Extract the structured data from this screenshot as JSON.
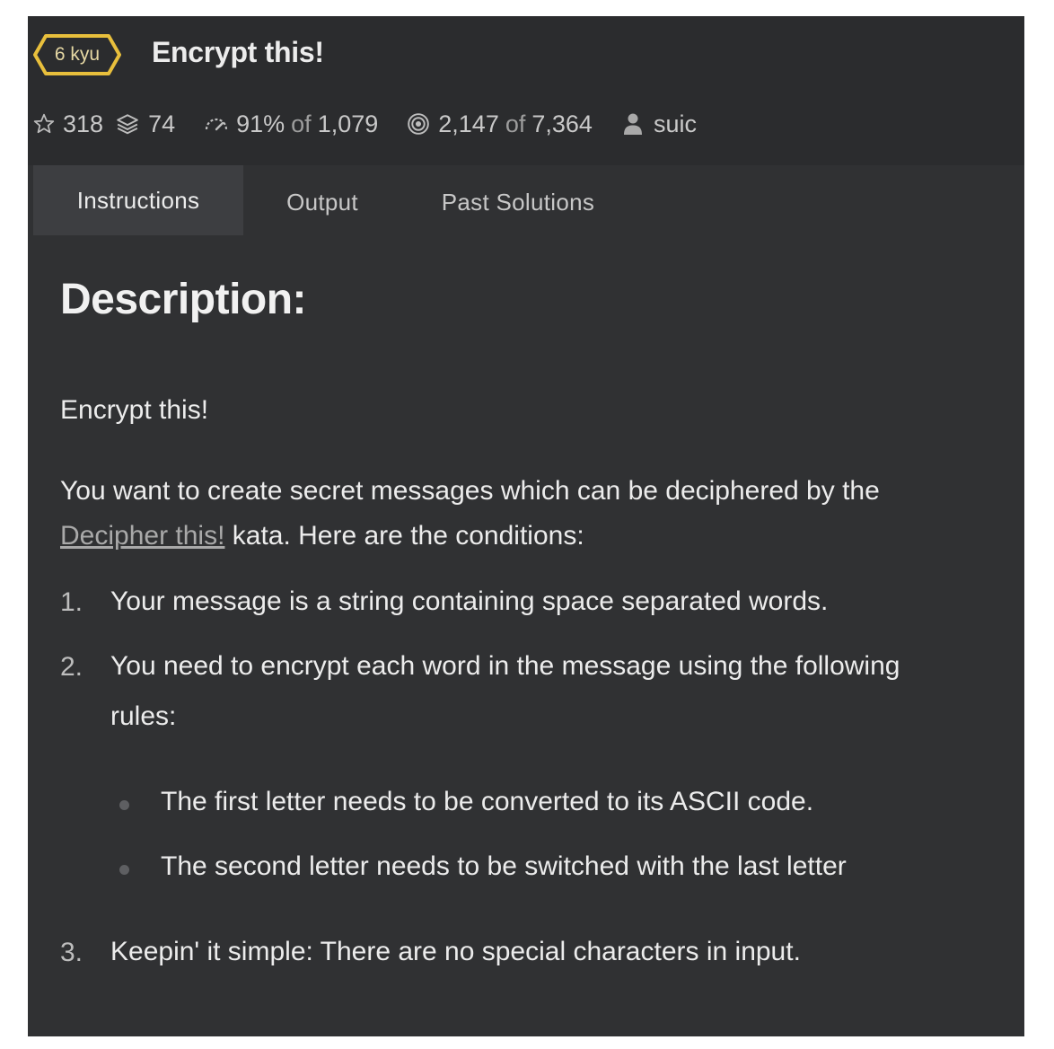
{
  "kata": {
    "rank": "6 kyu",
    "title": "Encrypt this!"
  },
  "stats": {
    "stars": "318",
    "collections": "74",
    "satisfaction_pct": "91%",
    "satisfaction_of": "of",
    "satisfaction_votes": "1,079",
    "completed": "2,147",
    "completed_of": "of",
    "attempted": "7,364",
    "author": "suic"
  },
  "tabs": {
    "instructions": "Instructions",
    "output": "Output",
    "past_solutions": "Past Solutions"
  },
  "description": {
    "heading": "Description:",
    "intro": "Encrypt this!",
    "para_prefix": "You want to create secret messages which can be deciphered by the",
    "link_text": "Decipher this!",
    "para_suffix": "kata. Here are the conditions:",
    "items": [
      {
        "num": "1.",
        "text": "Your message is a string containing space separated words."
      },
      {
        "num": "2.",
        "text": "You need to encrypt each word in the message using the following rules:"
      },
      {
        "num": "3.",
        "text": "Keepin' it simple: There are no special characters in input."
      }
    ],
    "rules": [
      "The first letter needs to be converted to its ASCII code.",
      "The second letter needs to be switched with the last letter"
    ]
  },
  "colors": {
    "rank_border": "#e8bf3c",
    "page_bg": "#303133",
    "header_bg": "#2b2c2e",
    "active_tab_bg": "#3d3e41"
  },
  "icons": {
    "stars": "star-outline-icon",
    "collections": "layers-icon",
    "satisfaction": "gauge-icon",
    "completions": "target-icon",
    "author": "user-icon"
  }
}
